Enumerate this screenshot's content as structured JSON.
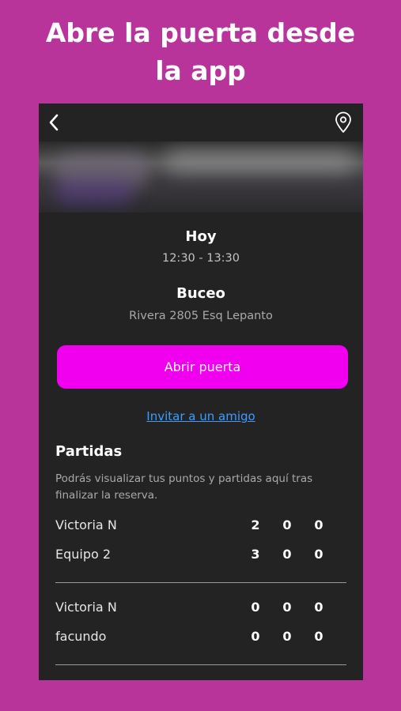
{
  "promo": {
    "title": "Abre la puerta desde\nla app"
  },
  "booking": {
    "day": "Hoy",
    "time": "12:30 - 13:30",
    "place": "Buceo",
    "address": "Rivera 2805 Esq Lepanto"
  },
  "actions": {
    "open_door": "Abrir puerta",
    "invite": "Invitar a un amigo"
  },
  "matches": {
    "title": "Partidas",
    "description": "Podrás visualizar tus puntos y partidas aquí tras finalizar la reserva.",
    "games": [
      {
        "rows": [
          {
            "name": "Victoria N",
            "scores": [
              "2",
              "0",
              "0"
            ]
          },
          {
            "name": "Equipo 2",
            "scores": [
              "3",
              "0",
              "0"
            ]
          }
        ]
      },
      {
        "rows": [
          {
            "name": "Victoria N",
            "scores": [
              "0",
              "0",
              "0"
            ]
          },
          {
            "name": "facundo",
            "scores": [
              "0",
              "0",
              "0"
            ]
          }
        ]
      }
    ]
  },
  "colors": {
    "background": "#b8339a",
    "panel": "#232323",
    "accent": "#f000ee",
    "link": "#3b9dff"
  },
  "icons": {
    "back": "chevron-left-icon",
    "location": "map-pin-icon"
  }
}
